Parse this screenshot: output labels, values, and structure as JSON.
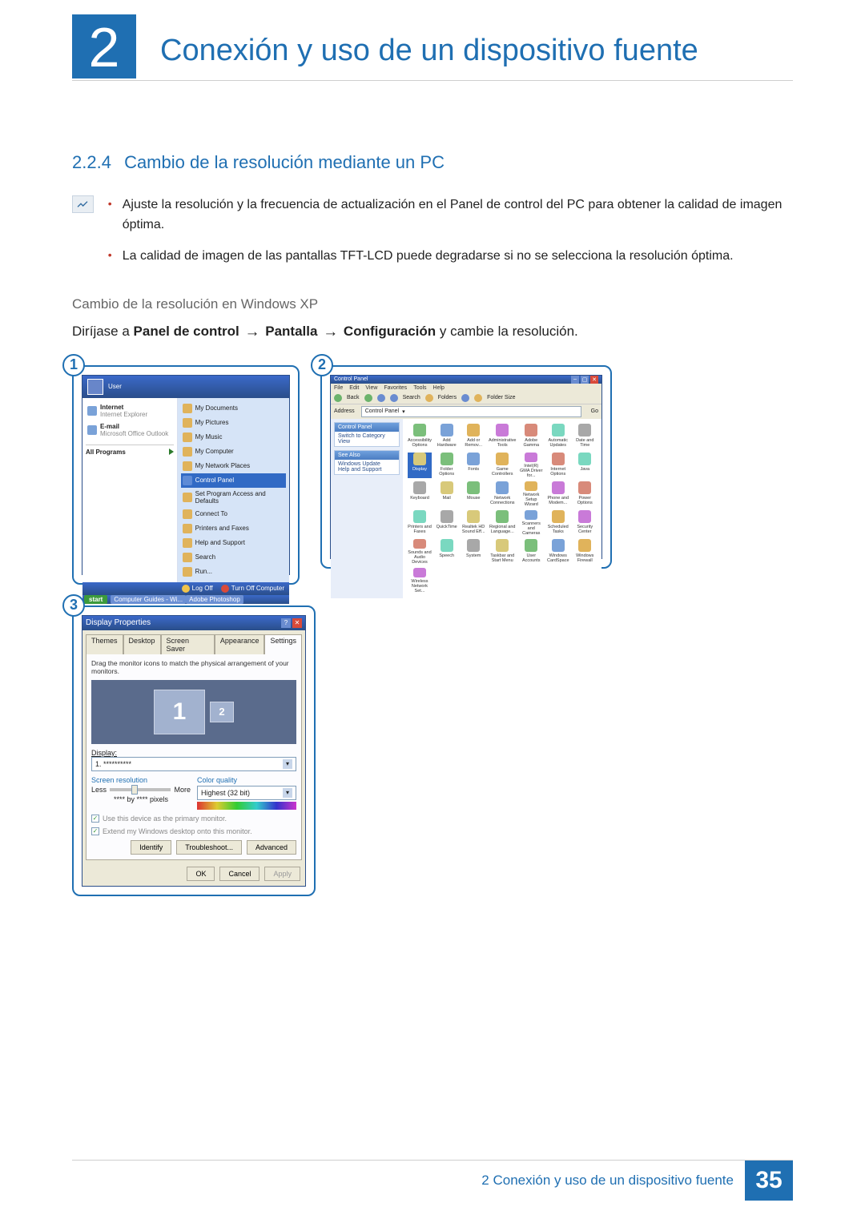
{
  "chapter": {
    "number": "2",
    "title": "Conexión y uso de un dispositivo fuente"
  },
  "section": {
    "number": "2.2.4",
    "title": "Cambio de la resolución mediante un PC"
  },
  "bullets": [
    "Ajuste la resolución y la frecuencia de actualización en el Panel de control del PC para obtener la calidad de imagen óptima.",
    "La calidad de imagen de las pantallas TFT-LCD puede degradarse si no se selecciona la resolución óptima."
  ],
  "subhead": "Cambio de la resolución en Windows XP",
  "instruction": {
    "lead": "Diríjase a ",
    "p1": "Panel de control",
    "p2": "Pantalla",
    "p3": "Configuración",
    "tail": " y cambie la resolución."
  },
  "callouts": [
    "1",
    "2",
    "3"
  ],
  "startmenu": {
    "user": "User",
    "left": [
      {
        "title": "Internet",
        "sub": "Internet Explorer"
      },
      {
        "title": "E-mail",
        "sub": "Microsoft Office Outlook"
      }
    ],
    "all_programs": "All Programs",
    "right": [
      "My Documents",
      "My Pictures",
      "My Music",
      "My Computer",
      "My Network Places",
      "Control Panel",
      "Set Program Access and Defaults",
      "Connect To",
      "Printers and Faxes",
      "Help and Support",
      "Search",
      "Run..."
    ],
    "highlight_index": 5,
    "logoff": "Log Off",
    "shutdown": "Turn Off Computer",
    "start": "start",
    "tasks": [
      "Computer Guides - Wi...",
      "Adobe Photoshop"
    ]
  },
  "control_panel": {
    "title": "Control Panel",
    "menus": [
      "File",
      "Edit",
      "View",
      "Favorites",
      "Tools",
      "Help"
    ],
    "toolbar": {
      "back": "Back",
      "search": "Search",
      "folders": "Folders",
      "folder_size": "Folder Size"
    },
    "address_label": "Address",
    "address_value": "Control Panel",
    "go": "Go",
    "side": {
      "pane1_head": "Control Panel",
      "pane1_link": "Switch to Category View",
      "pane2_head": "See Also",
      "pane2_links": [
        "Windows Update",
        "Help and Support"
      ]
    },
    "icons": [
      "Accessibility Options",
      "Add Hardware",
      "Add or Remov...",
      "Administrative Tools",
      "Adobe Gamma",
      "Automatic Updates",
      "Date and Time",
      "Display",
      "Folder Options",
      "Fonts",
      "Game Controllers",
      "Intel(R) GMA Driver for...",
      "Internet Options",
      "Java",
      "Keyboard",
      "Mail",
      "Mouse",
      "Network Connections",
      "Network Setup Wizard",
      "Phone and Modem...",
      "Power Options",
      "Printers and Faxes",
      "QuickTime",
      "Realtek HD Sound Eff...",
      "Regional and Language...",
      "Scanners and Cameras",
      "Scheduled Tasks",
      "Security Center",
      "Sounds and Audio Devices",
      "Speech",
      "System",
      "Taskbar and Start Menu",
      "User Accounts",
      "Windows CardSpace",
      "Windows Firewall",
      "Wireless Network Set..."
    ],
    "highlight_index": 7
  },
  "display_props": {
    "title": "Display Properties",
    "tabs": [
      "Themes",
      "Desktop",
      "Screen Saver",
      "Appearance",
      "Settings"
    ],
    "active_tab": 4,
    "drag_instr": "Drag the monitor icons to match the physical arrangement of your monitors.",
    "mon1": "1",
    "mon2": "2",
    "display_label": "Display:",
    "display_value": "1. **********",
    "res_label": "Screen resolution",
    "res_less": "Less",
    "res_more": "More",
    "res_value": "**** by **** pixels",
    "color_label": "Color quality",
    "color_value": "Highest (32 bit)",
    "chk1": "Use this device as the primary monitor.",
    "chk2": "Extend my Windows desktop onto this monitor.",
    "btn_identify": "Identify",
    "btn_trouble": "Troubleshoot...",
    "btn_adv": "Advanced",
    "btn_ok": "OK",
    "btn_cancel": "Cancel",
    "btn_apply": "Apply"
  },
  "footer": {
    "label": "2 Conexión y uso de un dispositivo fuente",
    "page": "35"
  }
}
